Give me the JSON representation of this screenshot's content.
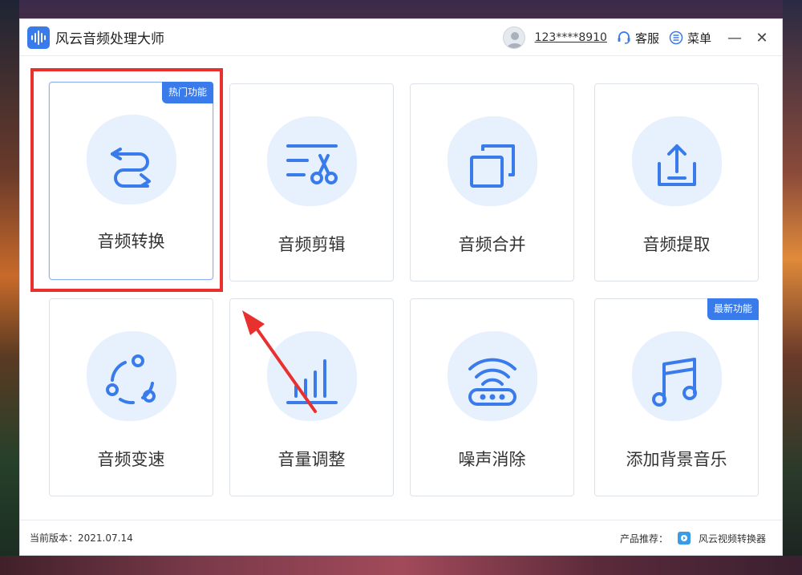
{
  "app": {
    "title": "风云音频处理大师",
    "account": "123****8910",
    "service_label": "客服",
    "menu_label": "菜单",
    "minimize_symbol": "—",
    "close_symbol": "✕"
  },
  "features": [
    {
      "label": "音频转换",
      "icon": "convert-arrows-icon",
      "tag": "热门功能"
    },
    {
      "label": "音频剪辑",
      "icon": "scissors-cut-icon",
      "tag": ""
    },
    {
      "label": "音频合并",
      "icon": "merge-windows-icon",
      "tag": ""
    },
    {
      "label": "音频提取",
      "icon": "export-tray-icon",
      "tag": ""
    },
    {
      "label": "音频变速",
      "icon": "speed-circle-icon",
      "tag": ""
    },
    {
      "label": "音量调整",
      "icon": "volume-bars-icon",
      "tag": ""
    },
    {
      "label": "噪声消除",
      "icon": "wifi-router-icon",
      "tag": ""
    },
    {
      "label": "添加背景音乐",
      "icon": "music-note-icon",
      "tag": "最新功能"
    }
  ],
  "footer": {
    "version_text": "当前版本：2021.07.14",
    "recommend_label": "产品推荐：",
    "recommend_product": "风云视频转换器"
  },
  "colors": {
    "accent": "#3a7bec",
    "highlight": "#e8312f",
    "icon_bg": "#e7f0fd"
  }
}
